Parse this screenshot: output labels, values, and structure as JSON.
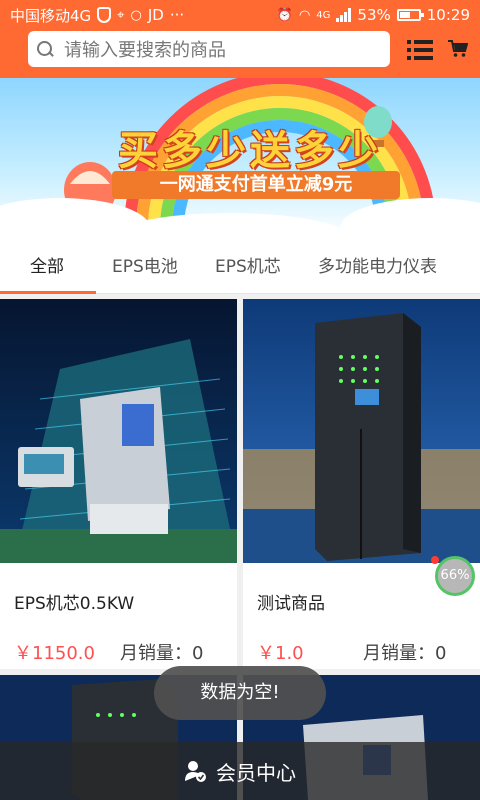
{
  "status_bar": {
    "carrier": "中国移动4G",
    "extra_text": "JD",
    "ellipsis": "···",
    "network": "4G",
    "battery_percent": "53%",
    "battery_level": 0.53,
    "time": "10:29",
    "icons": [
      "shield-icon",
      "location-icon",
      "chat-icon",
      "alarm-icon",
      "wifi-icon",
      "signal-icon",
      "battery-icon"
    ]
  },
  "search": {
    "placeholder": "请输入要搜索的商品"
  },
  "banner": {
    "title": "买多少送多少",
    "subtitle": "一网通支付首单立减9元"
  },
  "tabs": [
    {
      "label": "全部",
      "active": true
    },
    {
      "label": "EPS电池",
      "active": false
    },
    {
      "label": "EPS机芯",
      "active": false
    },
    {
      "label": "多功能电力仪表",
      "active": false
    }
  ],
  "products": [
    {
      "name": "EPS机芯0.5KW",
      "price": "￥1150.0",
      "sales": "月销量：0"
    },
    {
      "name": "测试商品",
      "price": "￥1.0",
      "sales": "月销量：0"
    }
  ],
  "badge": {
    "text": "66%"
  },
  "toast": {
    "text": "数据为空!"
  },
  "bottom_bar": {
    "label": "会员中心",
    "icon": "member-icon"
  },
  "colors": {
    "accent": "#ff6a33",
    "price": "#ff5050"
  }
}
